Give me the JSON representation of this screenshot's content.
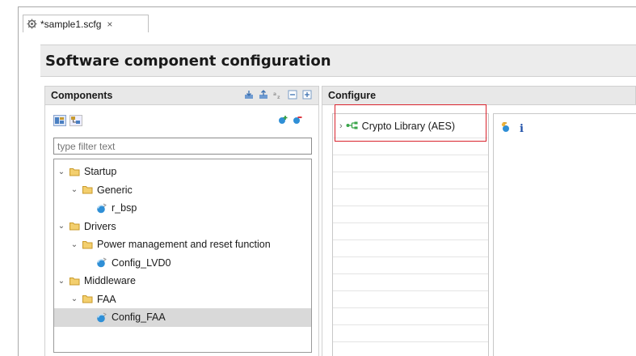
{
  "editor_tab": {
    "title": "*sample1.scfg",
    "close": "×"
  },
  "page_title": "Software component configuration",
  "components": {
    "header": "Components",
    "filter_placeholder": "type filter text",
    "tree": [
      {
        "label": "Startup",
        "kind": "folder",
        "level": 0,
        "expanded": true
      },
      {
        "label": "Generic",
        "kind": "folder",
        "level": 1,
        "expanded": true
      },
      {
        "label": "r_bsp",
        "kind": "component",
        "level": 2
      },
      {
        "label": "Drivers",
        "kind": "folder",
        "level": 0,
        "expanded": true
      },
      {
        "label": "Power management and reset function",
        "kind": "folder",
        "level": 1,
        "expanded": true
      },
      {
        "label": "Config_LVD0",
        "kind": "component",
        "level": 2
      },
      {
        "label": "Middleware",
        "kind": "folder",
        "level": 0,
        "expanded": true
      },
      {
        "label": "FAA",
        "kind": "folder",
        "level": 1,
        "expanded": true
      },
      {
        "label": "Config_FAA",
        "kind": "component",
        "level": 2,
        "selected": true
      }
    ]
  },
  "configure": {
    "header": "Configure",
    "item_label": "Crypto Library (AES)"
  },
  "colors": {
    "highlight": "#d9232d",
    "selection": "#d9d9d9",
    "folder": "#e8b84a",
    "component": "#2f8fd6"
  }
}
